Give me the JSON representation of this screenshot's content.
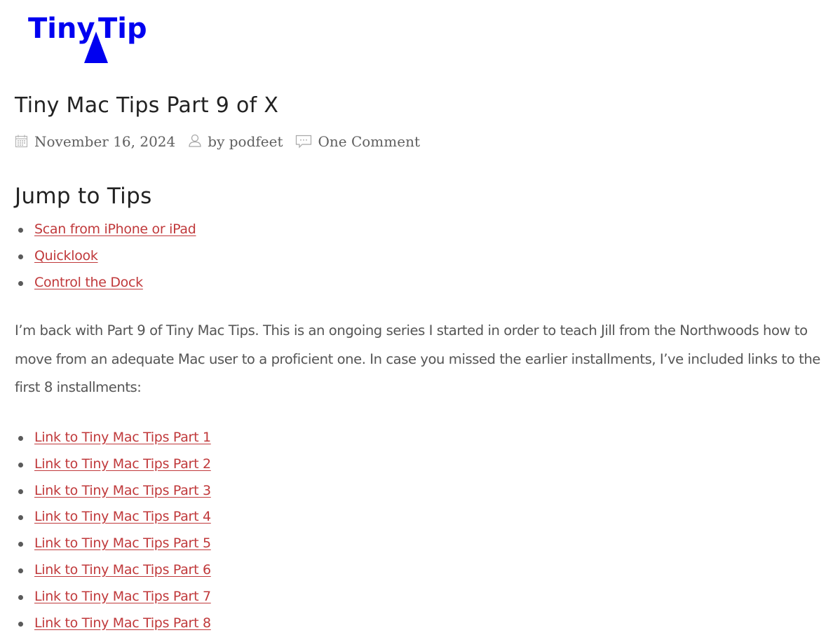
{
  "site": {
    "logo_text_left": "Tiny",
    "logo_text_right": "Tip",
    "logo_color": "#0000f0"
  },
  "post": {
    "title": "Tiny Mac Tips Part 9 of X",
    "meta": {
      "date": "November 16, 2024",
      "author": "by podfeet",
      "comments": "One Comment",
      "icons": [
        "calendar-icon",
        "user-icon",
        "comment-icon"
      ]
    },
    "jump_section": {
      "heading": "Jump to Tips",
      "links": [
        "Scan from iPhone or iPad",
        "Quicklook",
        "Control the Dock"
      ]
    },
    "intro_paragraph": "I’m back with Part 9 of Tiny Mac Tips. This is an ongoing series I started in order to teach Jill from the Northwoods how to move from an adequate Mac user to a proficient one. In case you missed the earlier installments, I’ve included links to the first 8 installments:",
    "previous_parts": [
      "Link to Tiny Mac Tips Part 1",
      "Link to Tiny Mac Tips Part 2",
      "Link to Tiny Mac Tips Part 3",
      "Link to Tiny Mac Tips Part 4",
      "Link to Tiny Mac Tips Part 5",
      "Link to Tiny Mac Tips Part 6",
      "Link to Tiny Mac Tips Part 7",
      "Link to Tiny Mac Tips Part 8"
    ]
  },
  "colors": {
    "link": "#c0393b",
    "heading": "#222222",
    "body_text": "#555555",
    "meta_text": "#5f5f5f"
  }
}
